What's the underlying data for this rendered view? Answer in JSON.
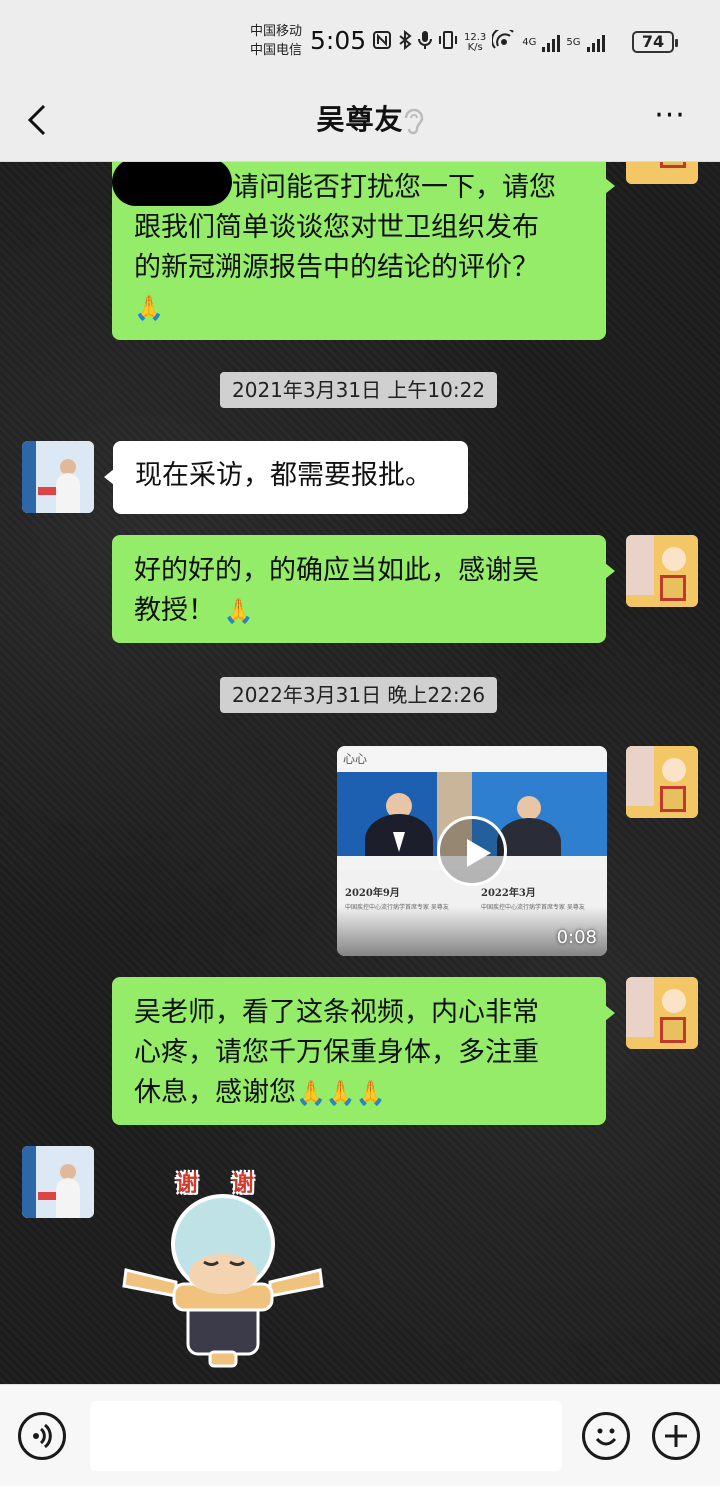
{
  "status_bar": {
    "carrier_1": "中国移动",
    "carrier_2": "中国电信",
    "time": "5:05",
    "speed_value": "12.3",
    "speed_unit": "K/s",
    "net_1": "4G",
    "net_2": "5G",
    "battery": "74",
    "icons": [
      "nfc-icon",
      "bluetooth-icon",
      "microphone-icon",
      "vibrate-icon",
      "hotspot-icon",
      "signal-icon"
    ]
  },
  "header": {
    "title": "吴尊友",
    "back_icon": "chevron-left-icon",
    "ear_icon": "earpiece-icon",
    "more_label": "···"
  },
  "messages": [
    {
      "sender": "me",
      "type": "text",
      "text_line1": "请问能否打扰您一下，请您",
      "text_line2": "跟我们简单谈谈您对世卫组织发布",
      "text_line3": "的新冠溯源报告中的结论的评价？",
      "emoji": "🙏"
    },
    {
      "type": "timestamp",
      "text": "2021年3月31日 上午10:22"
    },
    {
      "sender": "other",
      "type": "text",
      "text": "现在采访，都需要报批。"
    },
    {
      "sender": "me",
      "type": "text",
      "text_line1": "好的好的，的确应当如此，感谢吴",
      "text_line2": "教授！",
      "emoji": "🙏"
    },
    {
      "type": "timestamp",
      "text": "2022年3月31日 晚上22:26"
    },
    {
      "sender": "me",
      "type": "video",
      "logo": "心心",
      "caption_left": "2020年9月",
      "caption_right": "2022年3月",
      "sub_left": "中国疾控中心流行病学首席专家 吴尊友",
      "sub_right": "中国疾控中心流行病学首席专家 吴尊友",
      "duration": "0:08"
    },
    {
      "sender": "me",
      "type": "text",
      "text_line1": "吴老师，看了这条视频，内心非常",
      "text_line2": "心疼，请您千万保重身体，多注重",
      "text_line3": "休息，感谢您",
      "emoji": "🙏🙏🙏"
    },
    {
      "sender": "other",
      "type": "sticker",
      "text_1": "谢",
      "text_2": "谢"
    }
  ],
  "input_bar": {
    "voice_icon": "voice-icon",
    "emoji_icon": "smiley-icon",
    "plus_icon": "plus-icon",
    "value": ""
  },
  "colors": {
    "sent_bubble": "#95ec69",
    "received_bubble": "#ffffff",
    "bar_background": "#ededed"
  }
}
